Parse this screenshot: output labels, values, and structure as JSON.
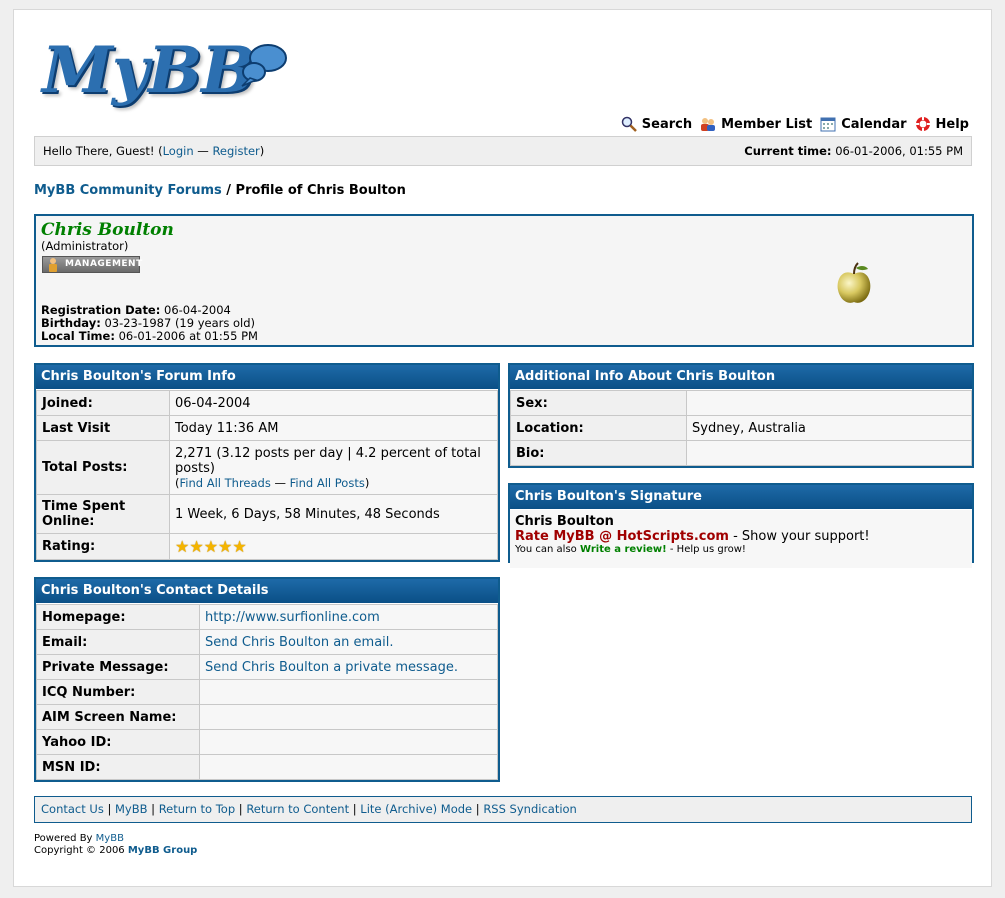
{
  "logo": {
    "text": "MyBB"
  },
  "menu": [
    {
      "label": "Search",
      "icon": "search-icon"
    },
    {
      "label": "Member List",
      "icon": "member-list-icon"
    },
    {
      "label": "Calendar",
      "icon": "calendar-icon"
    },
    {
      "label": "Help",
      "icon": "help-icon"
    }
  ],
  "panel": {
    "greeting_prefix": "Hello There, Guest! (",
    "login": "Login",
    "separator": " — ",
    "register": "Register",
    "greeting_suffix": ")",
    "time_label": "Current time:",
    "time_value": "06-01-2006, 01:55 PM"
  },
  "breadcrumb": {
    "home": "MyBB Community Forums",
    "separator": " / ",
    "current": "Profile of Chris Boulton"
  },
  "profile": {
    "name": "Chris Boulton",
    "title": "(Administrator)",
    "badge": "MANAGEMENT",
    "registration_label": "Registration Date:",
    "registration_value": "06-04-2004",
    "birthday_label": "Birthday:",
    "birthday_value": "03-23-1987 (19 years old)",
    "localtime_label": "Local Time:",
    "localtime_value": "06-01-2006 at 01:55 PM",
    "avatar_icon": "apple-avatar-icon"
  },
  "forum_info": {
    "heading": "Chris Boulton's Forum Info",
    "joined_label": "Joined:",
    "joined_value": "06-04-2004",
    "lastvisit_label": "Last Visit",
    "lastvisit_value": "Today 11:36 AM",
    "posts_label": "Total Posts:",
    "posts_value": "2,271 (3.12 posts per day | 4.2 percent of total posts)",
    "find_threads": "Find All Threads",
    "find_posts": "Find All Posts",
    "time_label": "Time Spent Online:",
    "time_value": "1 Week, 6 Days, 58 Minutes, 48 Seconds",
    "rating_label": "Rating:",
    "rating_stars": 5
  },
  "contact": {
    "heading": "Chris Boulton's Contact Details",
    "rows": [
      {
        "label": "Homepage:",
        "value": "http://www.surfionline.com"
      },
      {
        "label": "Email:",
        "value": "Send Chris Boulton an email."
      },
      {
        "label": "Private Message:",
        "value": "Send Chris Boulton a private message."
      },
      {
        "label": "ICQ Number:",
        "value": ""
      },
      {
        "label": "AIM Screen Name:",
        "value": ""
      },
      {
        "label": "Yahoo ID:",
        "value": ""
      },
      {
        "label": "MSN ID:",
        "value": ""
      }
    ]
  },
  "additional": {
    "heading": "Additional Info About Chris Boulton",
    "rows": [
      {
        "label": "Sex:",
        "value": ""
      },
      {
        "label": "Location:",
        "value": "Sydney, Australia"
      },
      {
        "label": "Bio:",
        "value": ""
      }
    ]
  },
  "signature": {
    "heading": "Chris Boulton's Signature",
    "name": "Chris Boulton",
    "rate_link": "Rate MyBB @ HotScripts.com",
    "rate_suffix": " - Show your support!",
    "also_prefix": "You can also ",
    "review_link": "Write a review!",
    "also_suffix": " - Help us grow!"
  },
  "footer": {
    "links": [
      "Contact Us",
      "MyBB",
      "Return to Top",
      "Return to Content",
      "Lite (Archive) Mode",
      "RSS Syndication"
    ],
    "separator": " | "
  },
  "copyright": {
    "powered_prefix": "Powered By ",
    "powered_link": "MyBB",
    "copy_prefix": "Copyright © 2006 ",
    "copy_link": "MyBB Group"
  },
  "colors": {
    "brand": "#0f5c8e",
    "name_green": "#008000",
    "signature_red": "#a00000"
  }
}
